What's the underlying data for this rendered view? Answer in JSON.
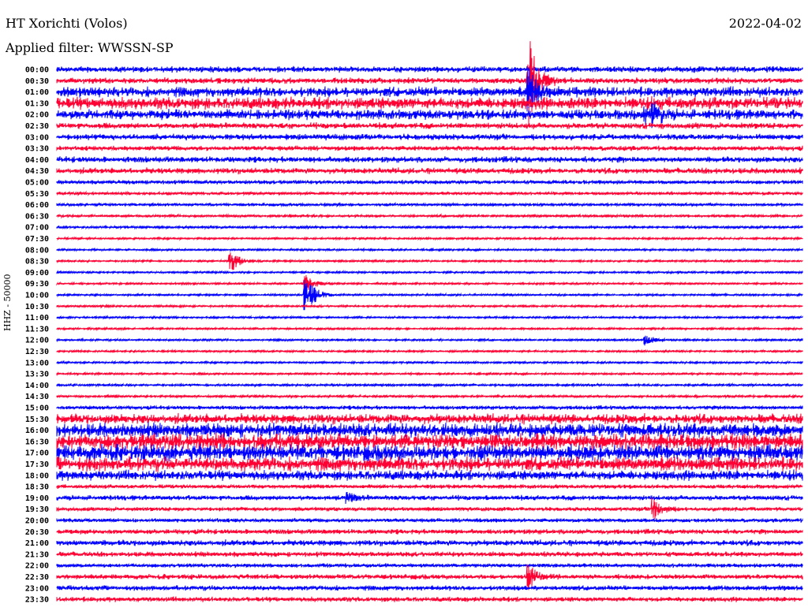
{
  "header": {
    "station": "HT Xorichti (Volos)",
    "filter": "Applied filter: WWSSN-SP",
    "date": "2022-04-02"
  },
  "chart_data": {
    "type": "line",
    "title": "HT Xorichti (Volos)",
    "ylabel": "HHZ - 50000",
    "xlabel": "",
    "colors": [
      "#0000ff",
      "#ff0033"
    ],
    "rows": [
      {
        "time": "00:00",
        "noise": 3
      },
      {
        "time": "00:30",
        "noise": 3
      },
      {
        "time": "01:00",
        "noise": 5
      },
      {
        "time": "01:30",
        "noise": 6
      },
      {
        "time": "02:00",
        "noise": 5
      },
      {
        "time": "02:30",
        "noise": 3
      },
      {
        "time": "03:00",
        "noise": 3
      },
      {
        "time": "03:30",
        "noise": 2.5
      },
      {
        "time": "04:00",
        "noise": 3
      },
      {
        "time": "04:30",
        "noise": 3
      },
      {
        "time": "05:00",
        "noise": 2
      },
      {
        "time": "05:30",
        "noise": 1.5
      },
      {
        "time": "06:00",
        "noise": 1.5
      },
      {
        "time": "06:30",
        "noise": 1.3
      },
      {
        "time": "07:00",
        "noise": 1.3
      },
      {
        "time": "07:30",
        "noise": 1
      },
      {
        "time": "08:00",
        "noise": 1
      },
      {
        "time": "08:30",
        "noise": 1
      },
      {
        "time": "09:00",
        "noise": 1
      },
      {
        "time": "09:30",
        "noise": 1
      },
      {
        "time": "10:00",
        "noise": 1
      },
      {
        "time": "10:30",
        "noise": 1
      },
      {
        "time": "11:00",
        "noise": 1
      },
      {
        "time": "11:30",
        "noise": 1
      },
      {
        "time": "12:00",
        "noise": 1
      },
      {
        "time": "12:30",
        "noise": 1
      },
      {
        "time": "13:00",
        "noise": 1
      },
      {
        "time": "13:30",
        "noise": 1
      },
      {
        "time": "14:00",
        "noise": 1.2
      },
      {
        "time": "14:30",
        "noise": 1.2
      },
      {
        "time": "15:00",
        "noise": 2
      },
      {
        "time": "15:30",
        "noise": 5
      },
      {
        "time": "16:00",
        "noise": 7
      },
      {
        "time": "16:30",
        "noise": 8
      },
      {
        "time": "17:00",
        "noise": 8
      },
      {
        "time": "17:30",
        "noise": 7
      },
      {
        "time": "18:00",
        "noise": 5
      },
      {
        "time": "18:30",
        "noise": 2
      },
      {
        "time": "19:00",
        "noise": 2.5
      },
      {
        "time": "19:30",
        "noise": 2
      },
      {
        "time": "20:00",
        "noise": 2
      },
      {
        "time": "20:30",
        "noise": 2.5
      },
      {
        "time": "21:00",
        "noise": 3
      },
      {
        "time": "21:30",
        "noise": 2.5
      },
      {
        "time": "22:00",
        "noise": 2
      },
      {
        "time": "22:30",
        "noise": 2.5
      },
      {
        "time": "23:00",
        "noise": 2.5
      },
      {
        "time": "23:30",
        "noise": 2.5
      }
    ],
    "events": [
      {
        "row": 1,
        "minute": 19,
        "amp": 60
      },
      {
        "row": 2,
        "minute": 19,
        "amp": 25
      },
      {
        "row": 4,
        "minute": 24,
        "amp": 10
      },
      {
        "row": 17,
        "minute": 7,
        "amp": 14
      },
      {
        "row": 20,
        "minute": 10,
        "amp": 30
      },
      {
        "row": 19,
        "minute": 10,
        "amp": 12
      },
      {
        "row": 39,
        "minute": 24,
        "amp": 14
      },
      {
        "row": 45,
        "minute": 19,
        "amp": 14
      },
      {
        "row": 4,
        "minute": 23.7,
        "amp": 8
      },
      {
        "row": 38,
        "minute": 11.7,
        "amp": 6
      },
      {
        "row": 24,
        "minute": 23.7,
        "amp": 6
      }
    ]
  }
}
